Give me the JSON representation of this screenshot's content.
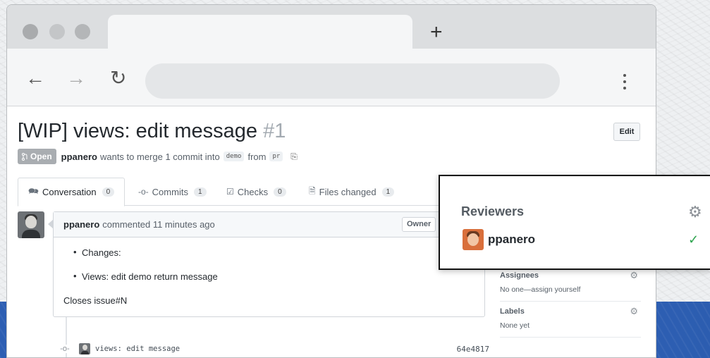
{
  "browser": {
    "new_tab_label": "+",
    "back_icon": "←",
    "forward_icon": "→",
    "reload_icon": "↻",
    "address": ""
  },
  "pr": {
    "title": "[WIP] views: edit message",
    "number": "#1",
    "edit_label": "Edit",
    "state": "Open",
    "author": "ppanero",
    "merge_text": "wants to merge 1 commit into",
    "base_branch": "demo",
    "from_text": "from",
    "head_branch": "pr"
  },
  "tabs": [
    {
      "label": "Conversation",
      "count": "0",
      "icon": "conversation-icon"
    },
    {
      "label": "Commits",
      "count": "1",
      "icon": "commit-icon"
    },
    {
      "label": "Checks",
      "count": "0",
      "icon": "checklist-icon"
    },
    {
      "label": "Files changed",
      "count": "1",
      "icon": "file-diff-icon"
    }
  ],
  "comment": {
    "author": "ppanero",
    "meta": "commented 11 minutes ago",
    "role": "Owner",
    "bullets": [
      "Changes:",
      "Views: edit demo return message"
    ],
    "closing": "Closes issue#N"
  },
  "commit": {
    "message": "views: edit message",
    "sha": "64e4817"
  },
  "sidebar": {
    "assignees_title": "Assignees",
    "assignees_value": "No one—assign yourself",
    "labels_title": "Labels",
    "labels_value": "None yet"
  },
  "reviewers_popout": {
    "title": "Reviewers",
    "reviewer": "ppanero",
    "status": "approved",
    "colors": {
      "check": "#2ea44f",
      "border": "#111111"
    }
  },
  "colors": {
    "badge_open": "#a9adb1",
    "background_blue": "#3568c0"
  }
}
